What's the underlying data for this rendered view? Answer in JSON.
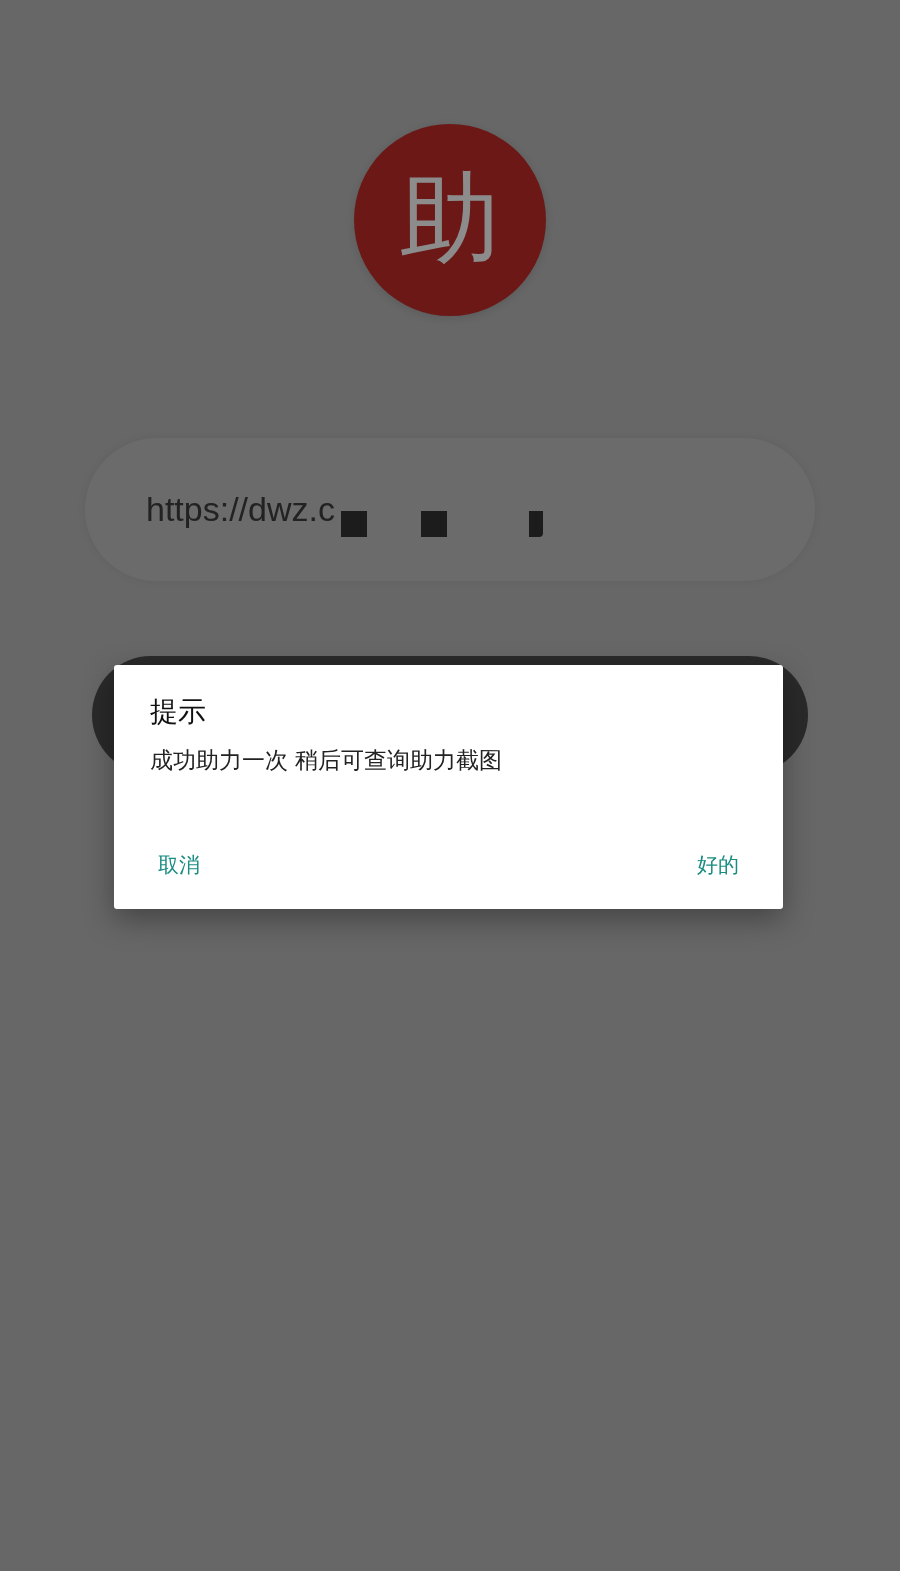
{
  "logo": {
    "text": "助"
  },
  "url_field": {
    "value": "https://dwz.c"
  },
  "dialog": {
    "title": "提示",
    "message": "成功助力一次 稍后可查询助力截图",
    "buttons": [
      {
        "label": "取消"
      },
      {
        "label": "好的"
      }
    ]
  }
}
